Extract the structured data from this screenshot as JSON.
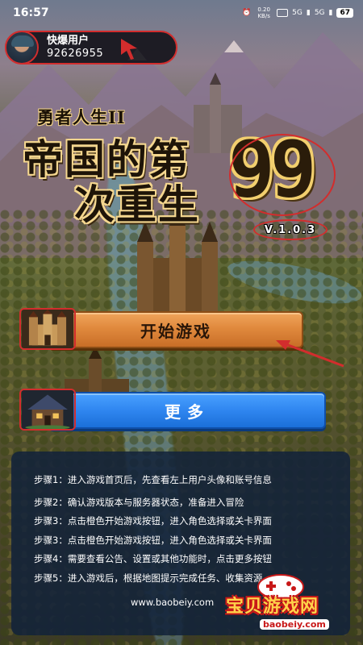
{
  "status_bar": {
    "time": "16:57",
    "net_speed": "0.20 KB/s",
    "signal1": "5G",
    "signal2": "5G",
    "battery": "67"
  },
  "user": {
    "name": "快爆用户",
    "id": "92626955"
  },
  "logo": {
    "subtitle": "勇者人生II",
    "line1": "帝国的第",
    "line2": "次重生",
    "number": "99",
    "version": "V.1.0.3"
  },
  "buttons": {
    "start_label": "开始游戏",
    "more_label": "更多"
  },
  "steps": [
    "步骤1：进入游戏首页后，先查看左上用户头像和账号信息",
    "步骤2：确认游戏版本与服务器状态，准备进入冒险",
    "步骤3：点击橙色开始游戏按钮，进入角色选择或关卡界面",
    "步骤3：点击橙色开始游戏按钮，进入角色选择或关卡界面",
    "步骤4：需要查看公告、设置或其他功能时，点击更多按钮",
    "步骤5：进入游戏后，根据地图提示完成任务、收集资源"
  ],
  "site": "www.baobeiy.com",
  "watermark": {
    "text": "宝贝游戏网",
    "url": "baobeiy.com"
  },
  "colors": {
    "annotation_red": "#d22d2d",
    "start_orange": "#e0893d",
    "more_blue": "#2f86f0",
    "panel_navy": "#12223a"
  }
}
